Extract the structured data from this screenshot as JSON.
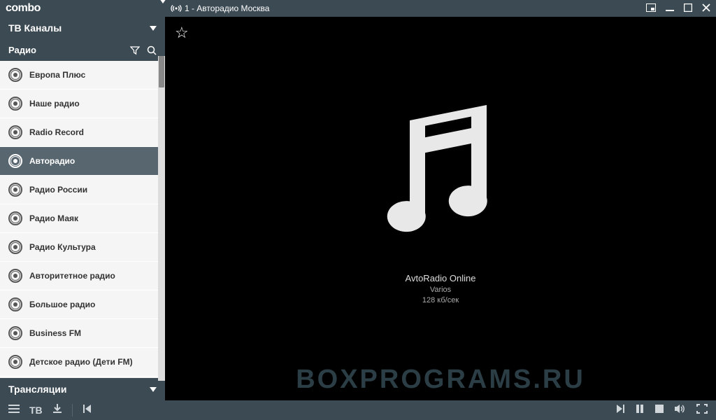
{
  "app": {
    "logo_text": "combo"
  },
  "titlebar": {
    "channel_label": "1 - Авторадио Москва"
  },
  "sidebar": {
    "tv_header": "ТВ Каналы",
    "radio_header": "Радио",
    "broadcast_header": "Трансляции",
    "items": [
      {
        "label": "Европа Плюс"
      },
      {
        "label": "Наше радио"
      },
      {
        "label": "Radio Record"
      },
      {
        "label": "Авторадио"
      },
      {
        "label": "Радио России"
      },
      {
        "label": "Радио Маяк"
      },
      {
        "label": "Радио Культура"
      },
      {
        "label": "Авторитетное радио"
      },
      {
        "label": "Большое радио"
      },
      {
        "label": "Business FM"
      },
      {
        "label": "Детское радио (Дети FM)"
      }
    ],
    "active_index": 3
  },
  "player": {
    "title": "AvtoRadio Online",
    "artist": "Varios",
    "bitrate": "128 кб/сек"
  },
  "bottombar": {
    "tv_label": "ТВ"
  },
  "watermark": "BOXPROGRAMS.RU"
}
